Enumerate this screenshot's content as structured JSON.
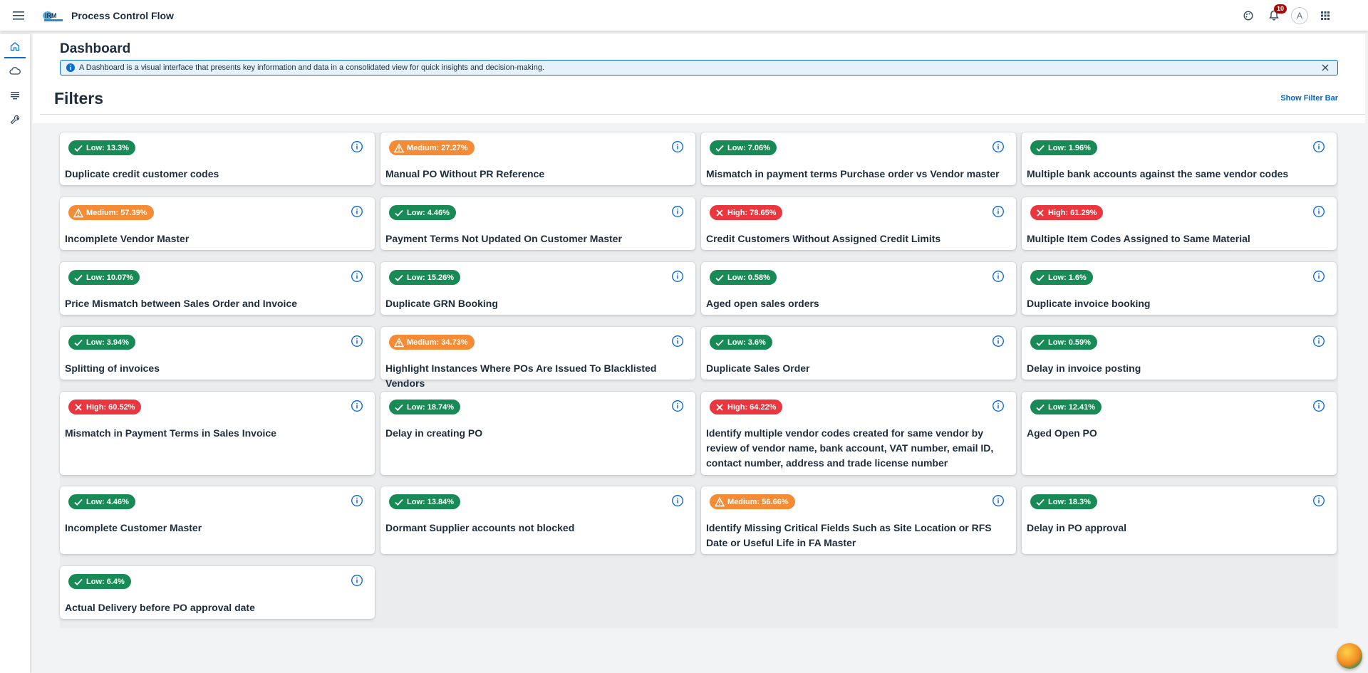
{
  "app": {
    "title": "Process Control Flow",
    "logo_text": "IRM"
  },
  "shell": {
    "notification_count": "10",
    "avatar_initial": "A"
  },
  "page": {
    "title": "Dashboard",
    "info_message": "A Dashboard is a visual interface that presents key information and data in a consolidated view for quick insights and decision-making.",
    "filters_title": "Filters",
    "filter_bar_link": "Show Filter Bar"
  },
  "colors": {
    "low": "#188a56",
    "medium": "#f58b35",
    "high": "#e9363f",
    "accent": "#0a6ed1"
  },
  "cards": [
    {
      "level": "low",
      "badge": "Low: 13.3%",
      "title": "Duplicate credit customer codes"
    },
    {
      "level": "medium",
      "badge": "Medium: 27.27%",
      "title": "Manual PO Without PR Reference"
    },
    {
      "level": "low",
      "badge": "Low: 7.06%",
      "title": "Mismatch in payment terms Purchase order vs Vendor master"
    },
    {
      "level": "low",
      "badge": "Low: 1.96%",
      "title": "Multiple bank accounts against the same vendor codes"
    },
    {
      "level": "medium",
      "badge": "Medium: 57.39%",
      "title": "Incomplete Vendor Master"
    },
    {
      "level": "low",
      "badge": "Low: 4.46%",
      "title": "Payment Terms Not Updated On Customer Master"
    },
    {
      "level": "high",
      "badge": "High: 78.65%",
      "title": "Credit Customers Without Assigned Credit Limits"
    },
    {
      "level": "high",
      "badge": "High: 61.29%",
      "title": "Multiple Item Codes Assigned to Same Material"
    },
    {
      "level": "low",
      "badge": "Low: 10.07%",
      "title": "Price Mismatch between Sales Order and Invoice"
    },
    {
      "level": "low",
      "badge": "Low: 15.26%",
      "title": "Duplicate GRN Booking"
    },
    {
      "level": "low",
      "badge": "Low: 0.58%",
      "title": "Aged open sales orders"
    },
    {
      "level": "low",
      "badge": "Low: 1.6%",
      "title": "Duplicate invoice booking"
    },
    {
      "level": "low",
      "badge": "Low: 3.94%",
      "title": "Splitting of invoices"
    },
    {
      "level": "medium",
      "badge": "Medium: 34.73%",
      "title": "Highlight Instances Where POs Are Issued To Blacklisted Vendors"
    },
    {
      "level": "low",
      "badge": "Low: 3.6%",
      "title": "Duplicate Sales Order"
    },
    {
      "level": "low",
      "badge": "Low: 0.59%",
      "title": "Delay in invoice posting"
    },
    {
      "level": "high",
      "badge": "High: 60.52%",
      "title": "Mismatch in Payment Terms in Sales Invoice"
    },
    {
      "level": "low",
      "badge": "Low: 18.74%",
      "title": "Delay in creating PO"
    },
    {
      "level": "high",
      "badge": "High: 64.22%",
      "title": "Identify multiple vendor codes created for same vendor by review of vendor name, bank account, VAT number, email ID, contact number, address and trade license number"
    },
    {
      "level": "low",
      "badge": "Low: 12.41%",
      "title": "Aged Open PO"
    },
    {
      "level": "low",
      "badge": "Low: 4.46%",
      "title": "Incomplete Customer Master"
    },
    {
      "level": "low",
      "badge": "Low: 13.84%",
      "title": "Dormant Supplier accounts not blocked"
    },
    {
      "level": "medium",
      "badge": "Medium: 56.66%",
      "title": "Identify Missing Critical Fields Such as Site Location or RFS Date or Useful Life in FA Master"
    },
    {
      "level": "low",
      "badge": "Low: 18.3%",
      "title": "Delay in PO approval"
    },
    {
      "level": "low",
      "badge": "Low: 6.4%",
      "title": "Actual Delivery before PO approval date"
    }
  ]
}
